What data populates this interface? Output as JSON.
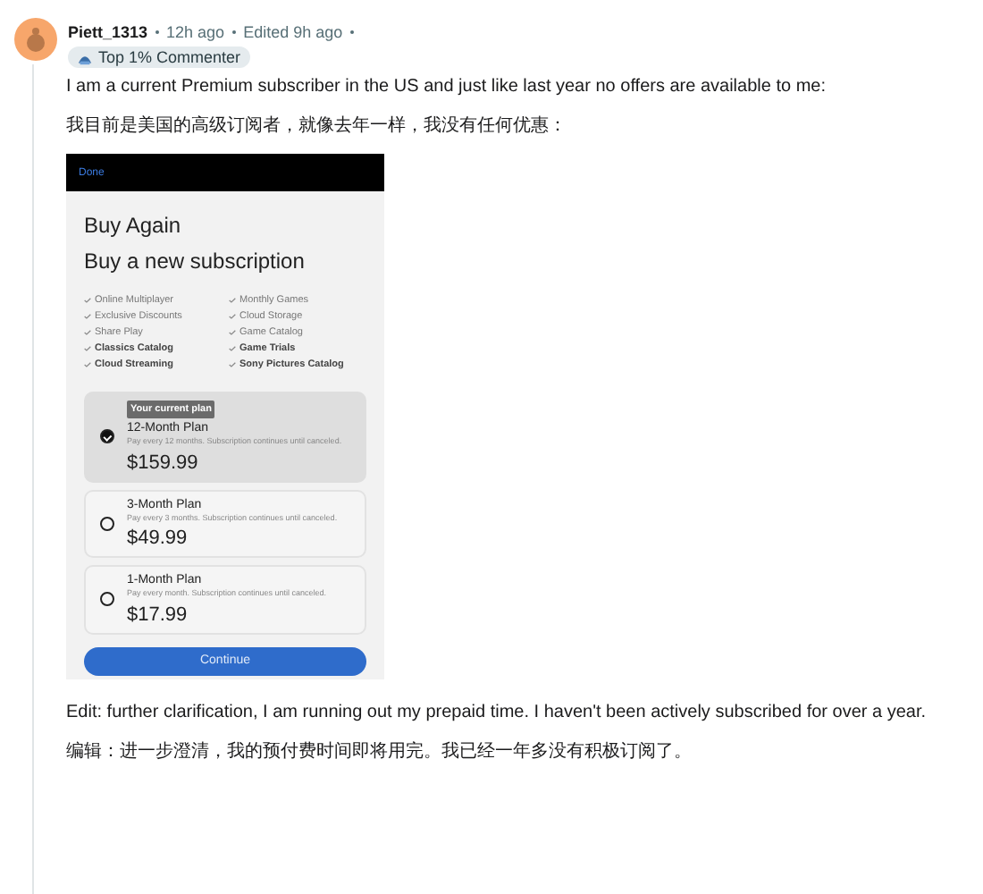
{
  "comment": {
    "author": "Piett_1313",
    "time": "12h ago",
    "edited": "Edited 9h ago",
    "badge": "Top 1% Commenter",
    "paragraphs": [
      "I am a current Premium subscriber in the US and just like last year no offers are available to me:",
      "我目前是美国的高级订阅者，就像去年一样，我没有任何优惠："
    ],
    "screenshot": {
      "header_link": "Done",
      "title": "Buy Again",
      "subtitle": "Buy a new subscription",
      "features": [
        {
          "label": "Online Multiplayer",
          "emphasized": false
        },
        {
          "label": "Monthly Games",
          "emphasized": false
        },
        {
          "label": "Exclusive Discounts",
          "emphasized": false
        },
        {
          "label": "Cloud Storage",
          "emphasized": false
        },
        {
          "label": "Share Play",
          "emphasized": false
        },
        {
          "label": "Game Catalog",
          "emphasized": false
        },
        {
          "label": "Classics Catalog",
          "emphasized": true
        },
        {
          "label": "Game Trials",
          "emphasized": true
        },
        {
          "label": "Cloud Streaming",
          "emphasized": true
        },
        {
          "label": "Sony Pictures Catalog",
          "emphasized": true
        }
      ],
      "plans": [
        {
          "badge": "Your current plan",
          "name": "12-Month Plan",
          "description": "Pay every 12 months. Subscription continues until canceled.",
          "price": "$159.99",
          "selected": true
        },
        {
          "name": "3-Month Plan",
          "description": "Pay every 3 months. Subscription continues until canceled.",
          "price": "$49.99",
          "selected": false
        },
        {
          "name": "1-Month Plan",
          "description": "Pay every month. Subscription continues until canceled.",
          "price": "$17.99",
          "selected": false
        }
      ],
      "button": "Continue"
    },
    "edit_paragraphs": [
      "Edit: further clarification, I am running out my prepaid time. I haven't been actively subscribed for over a year.",
      "编辑：进一步澄清，我的预付费时间即将用完。我已经一年多没有积极订阅了。"
    ]
  }
}
